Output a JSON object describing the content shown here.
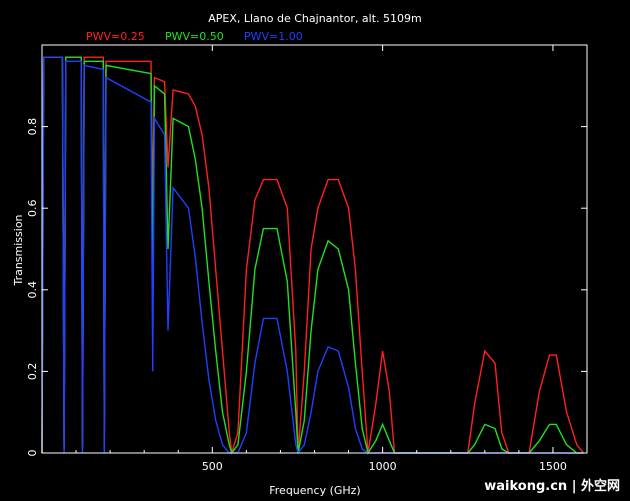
{
  "chart_data": {
    "type": "line",
    "title": "APEX, Llano de Chajnantor, alt. 5109m",
    "xlabel": "Frequency (GHz)",
    "ylabel": "Transmission",
    "xlim": [
      0,
      1600
    ],
    "ylim": [
      0,
      1.0
    ],
    "x_ticks": [
      500,
      1000,
      1500
    ],
    "y_ticks": [
      0,
      0.2,
      0.4,
      0.6,
      0.8
    ],
    "x_tick_labels": [
      "500",
      "1000",
      "1500"
    ],
    "y_tick_labels": [
      "0",
      "0.2",
      "0.4",
      "0.6",
      "0.8"
    ],
    "grid": false,
    "legend_position": "top-left",
    "series": [
      {
        "name": "PWV=0.25",
        "color": "#ff2020",
        "points": [
          [
            0,
            0
          ],
          [
            5,
            0.97
          ],
          [
            60,
            0.97
          ],
          [
            65,
            0.02
          ],
          [
            70,
            0.97
          ],
          [
            115,
            0.97
          ],
          [
            119,
            0.02
          ],
          [
            124,
            0.97
          ],
          [
            180,
            0.97
          ],
          [
            183,
            0.02
          ],
          [
            188,
            0.96
          ],
          [
            320,
            0.96
          ],
          [
            325,
            0.6
          ],
          [
            330,
            0.92
          ],
          [
            360,
            0.91
          ],
          [
            370,
            0.7
          ],
          [
            385,
            0.89
          ],
          [
            430,
            0.88
          ],
          [
            450,
            0.85
          ],
          [
            470,
            0.78
          ],
          [
            490,
            0.65
          ],
          [
            510,
            0.45
          ],
          [
            530,
            0.25
          ],
          [
            550,
            0.05
          ],
          [
            557,
            0.0
          ],
          [
            575,
            0.05
          ],
          [
            600,
            0.45
          ],
          [
            625,
            0.62
          ],
          [
            650,
            0.67
          ],
          [
            690,
            0.67
          ],
          [
            720,
            0.6
          ],
          [
            745,
            0.25
          ],
          [
            752,
            0.0
          ],
          [
            770,
            0.2
          ],
          [
            790,
            0.5
          ],
          [
            810,
            0.6
          ],
          [
            840,
            0.67
          ],
          [
            870,
            0.67
          ],
          [
            900,
            0.6
          ],
          [
            920,
            0.45
          ],
          [
            940,
            0.2
          ],
          [
            957,
            0.0
          ],
          [
            980,
            0.12
          ],
          [
            1000,
            0.25
          ],
          [
            1020,
            0.15
          ],
          [
            1035,
            0.0
          ],
          [
            1250,
            0.0
          ],
          [
            1270,
            0.12
          ],
          [
            1300,
            0.25
          ],
          [
            1330,
            0.22
          ],
          [
            1350,
            0.05
          ],
          [
            1370,
            0.0
          ],
          [
            1430,
            0.0
          ],
          [
            1460,
            0.15
          ],
          [
            1490,
            0.24
          ],
          [
            1510,
            0.24
          ],
          [
            1540,
            0.1
          ],
          [
            1570,
            0.02
          ],
          [
            1590,
            0.0
          ]
        ]
      },
      {
        "name": "PWV=0.50",
        "color": "#20e020",
        "points": [
          [
            0,
            0
          ],
          [
            5,
            0.97
          ],
          [
            60,
            0.97
          ],
          [
            65,
            0.01
          ],
          [
            70,
            0.97
          ],
          [
            115,
            0.97
          ],
          [
            119,
            0.01
          ],
          [
            124,
            0.96
          ],
          [
            180,
            0.96
          ],
          [
            183,
            0.01
          ],
          [
            188,
            0.95
          ],
          [
            320,
            0.93
          ],
          [
            325,
            0.4
          ],
          [
            330,
            0.9
          ],
          [
            360,
            0.88
          ],
          [
            370,
            0.5
          ],
          [
            385,
            0.82
          ],
          [
            430,
            0.8
          ],
          [
            450,
            0.72
          ],
          [
            470,
            0.6
          ],
          [
            490,
            0.42
          ],
          [
            510,
            0.25
          ],
          [
            530,
            0.1
          ],
          [
            550,
            0.02
          ],
          [
            557,
            0.0
          ],
          [
            575,
            0.02
          ],
          [
            600,
            0.2
          ],
          [
            625,
            0.45
          ],
          [
            650,
            0.55
          ],
          [
            690,
            0.55
          ],
          [
            720,
            0.42
          ],
          [
            745,
            0.1
          ],
          [
            752,
            0.0
          ],
          [
            770,
            0.08
          ],
          [
            790,
            0.3
          ],
          [
            810,
            0.45
          ],
          [
            840,
            0.52
          ],
          [
            870,
            0.5
          ],
          [
            900,
            0.4
          ],
          [
            920,
            0.22
          ],
          [
            940,
            0.06
          ],
          [
            957,
            0.0
          ],
          [
            980,
            0.03
          ],
          [
            1000,
            0.07
          ],
          [
            1020,
            0.03
          ],
          [
            1035,
            0.0
          ],
          [
            1250,
            0.0
          ],
          [
            1270,
            0.02
          ],
          [
            1300,
            0.07
          ],
          [
            1330,
            0.06
          ],
          [
            1350,
            0.01
          ],
          [
            1370,
            0.0
          ],
          [
            1430,
            0.0
          ],
          [
            1460,
            0.03
          ],
          [
            1490,
            0.07
          ],
          [
            1510,
            0.07
          ],
          [
            1540,
            0.02
          ],
          [
            1570,
            0.0
          ],
          [
            1590,
            0.0
          ]
        ]
      },
      {
        "name": "PWV=1.00",
        "color": "#2040ff",
        "points": [
          [
            0,
            0
          ],
          [
            5,
            0.97
          ],
          [
            60,
            0.97
          ],
          [
            65,
            0.0
          ],
          [
            70,
            0.96
          ],
          [
            115,
            0.96
          ],
          [
            119,
            0.0
          ],
          [
            124,
            0.95
          ],
          [
            180,
            0.94
          ],
          [
            183,
            0.0
          ],
          [
            188,
            0.92
          ],
          [
            320,
            0.86
          ],
          [
            325,
            0.2
          ],
          [
            330,
            0.82
          ],
          [
            360,
            0.78
          ],
          [
            370,
            0.3
          ],
          [
            385,
            0.65
          ],
          [
            430,
            0.6
          ],
          [
            450,
            0.48
          ],
          [
            470,
            0.32
          ],
          [
            490,
            0.18
          ],
          [
            510,
            0.08
          ],
          [
            530,
            0.02
          ],
          [
            550,
            0.0
          ],
          [
            557,
            0.0
          ],
          [
            575,
            0.0
          ],
          [
            600,
            0.05
          ],
          [
            625,
            0.22
          ],
          [
            650,
            0.33
          ],
          [
            690,
            0.33
          ],
          [
            720,
            0.2
          ],
          [
            745,
            0.02
          ],
          [
            752,
            0.0
          ],
          [
            770,
            0.02
          ],
          [
            790,
            0.1
          ],
          [
            810,
            0.2
          ],
          [
            840,
            0.26
          ],
          [
            870,
            0.25
          ],
          [
            900,
            0.16
          ],
          [
            920,
            0.06
          ],
          [
            940,
            0.01
          ],
          [
            957,
            0.0
          ],
          [
            980,
            0.0
          ],
          [
            1000,
            0.0
          ],
          [
            1020,
            0.0
          ],
          [
            1035,
            0.0
          ],
          [
            1590,
            0.0
          ]
        ]
      }
    ]
  },
  "watermark": "waikong.cn | 外空网"
}
